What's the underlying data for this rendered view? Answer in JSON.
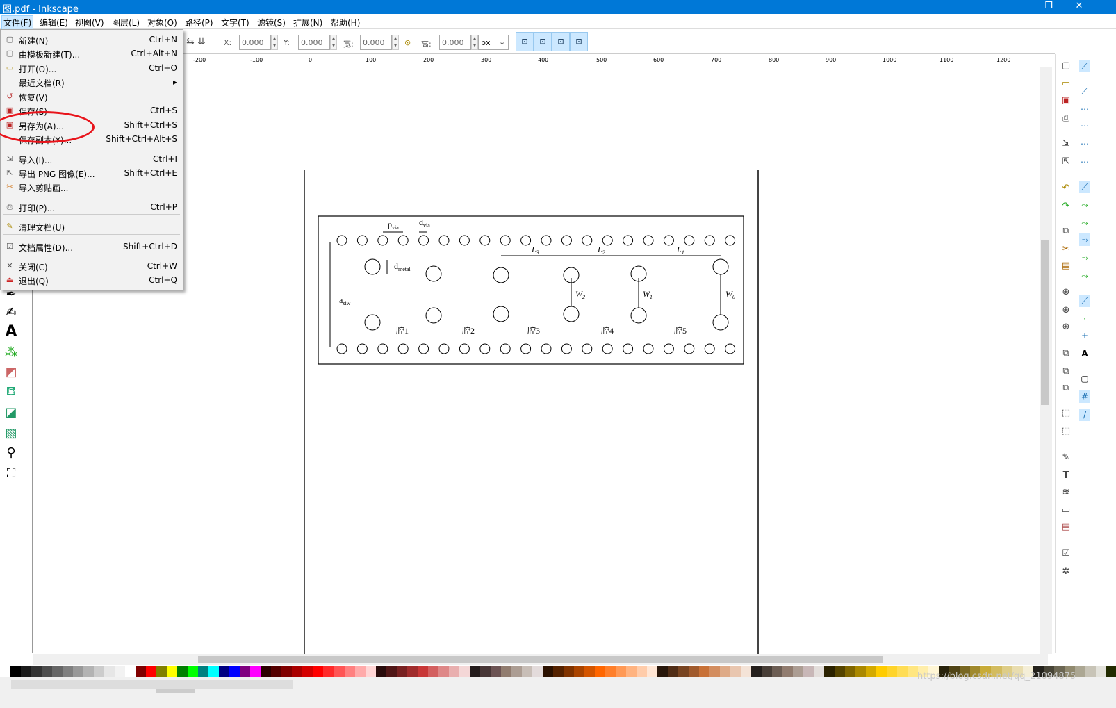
{
  "app": {
    "title": "图.pdf - Inkscape",
    "min": "—",
    "max": "❐",
    "close": "✕"
  },
  "menubar": [
    {
      "label": "文件(F)"
    },
    {
      "label": "编辑(E)"
    },
    {
      "label": "视图(V)"
    },
    {
      "label": "图层(L)"
    },
    {
      "label": "对象(O)"
    },
    {
      "label": "路径(P)"
    },
    {
      "label": "文字(T)"
    },
    {
      "label": "滤镜(S)"
    },
    {
      "label": "扩展(N)"
    },
    {
      "label": "帮助(H)"
    }
  ],
  "file_menu": [
    {
      "label": "新建(N)",
      "shortcut": "Ctrl+N",
      "icon": "new-doc-icon"
    },
    {
      "label": "由模板新建(T)...",
      "shortcut": "Ctrl+Alt+N",
      "icon": "template-icon"
    },
    {
      "label": "打开(O)...",
      "shortcut": "Ctrl+O",
      "icon": "open-folder-icon"
    },
    {
      "label": "最近文档(R)",
      "shortcut": "▸",
      "icon": ""
    },
    {
      "label": "恢复(V)",
      "shortcut": "",
      "icon": "revert-icon"
    },
    {
      "label": "保存(S)",
      "shortcut": "Ctrl+S",
      "icon": "save-icon"
    },
    {
      "label": "另存为(A)...",
      "shortcut": "Shift+Ctrl+S",
      "icon": "save-as-icon"
    },
    {
      "label": "保存副本(Y)...",
      "shortcut": "Shift+Ctrl+Alt+S",
      "icon": ""
    },
    {
      "label": "导入(I)...",
      "shortcut": "Ctrl+I",
      "icon": "import-icon"
    },
    {
      "label": "导出 PNG 图像(E)...",
      "shortcut": "Shift+Ctrl+E",
      "icon": "export-png-icon"
    },
    {
      "label": "导入剪贴画...",
      "shortcut": "",
      "icon": "clipart-icon"
    },
    {
      "label": "打印(P)...",
      "shortcut": "Ctrl+P",
      "icon": "print-icon"
    },
    {
      "label": "清理文档(U)",
      "shortcut": "",
      "icon": "cleanup-icon"
    },
    {
      "label": "文档属性(D)...",
      "shortcut": "Shift+Ctrl+D",
      "icon": "doc-props-icon"
    },
    {
      "label": "关闭(C)",
      "shortcut": "Ctrl+W",
      "icon": "close-doc-icon"
    },
    {
      "label": "退出(Q)",
      "shortcut": "Ctrl+Q",
      "icon": "quit-icon"
    }
  ],
  "toolbar": {
    "x_label": "X:",
    "x_value": "0.000",
    "y_label": "Y:",
    "y_value": "0.000",
    "w_label": "宽:",
    "w_value": "0.000",
    "h_label": "高:",
    "h_value": "0.000",
    "unit": "px"
  },
  "ruler_ticks": [
    "-200",
    "-100",
    "0",
    "100",
    "200",
    "300",
    "400",
    "500",
    "600",
    "700",
    "800",
    "900",
    "1000",
    "1100",
    "1200"
  ],
  "figure": {
    "p_via": "p",
    "p_via_sub": "via",
    "d_via": "d",
    "d_via_sub": "via",
    "d_metal": "d",
    "d_metal_sub": "metal",
    "a_siw": "a",
    "a_siw_sub": "siw",
    "L3": "L",
    "L3_sub": "3",
    "L2": "L",
    "L2_sub": "2",
    "L1": "L",
    "L1_sub": "1",
    "W2": "W",
    "W2_sub": "2",
    "W1": "W",
    "W1_sub": "1",
    "W0": "W",
    "W0_sub": "0",
    "cavities": [
      "腔1",
      "腔2",
      "腔3",
      "腔4",
      "腔5"
    ]
  },
  "watermark": "https://blog.csdn.net/qq_21094875",
  "colors": {
    "titlebar": "#0078d7",
    "highlight": "#e8141b"
  }
}
